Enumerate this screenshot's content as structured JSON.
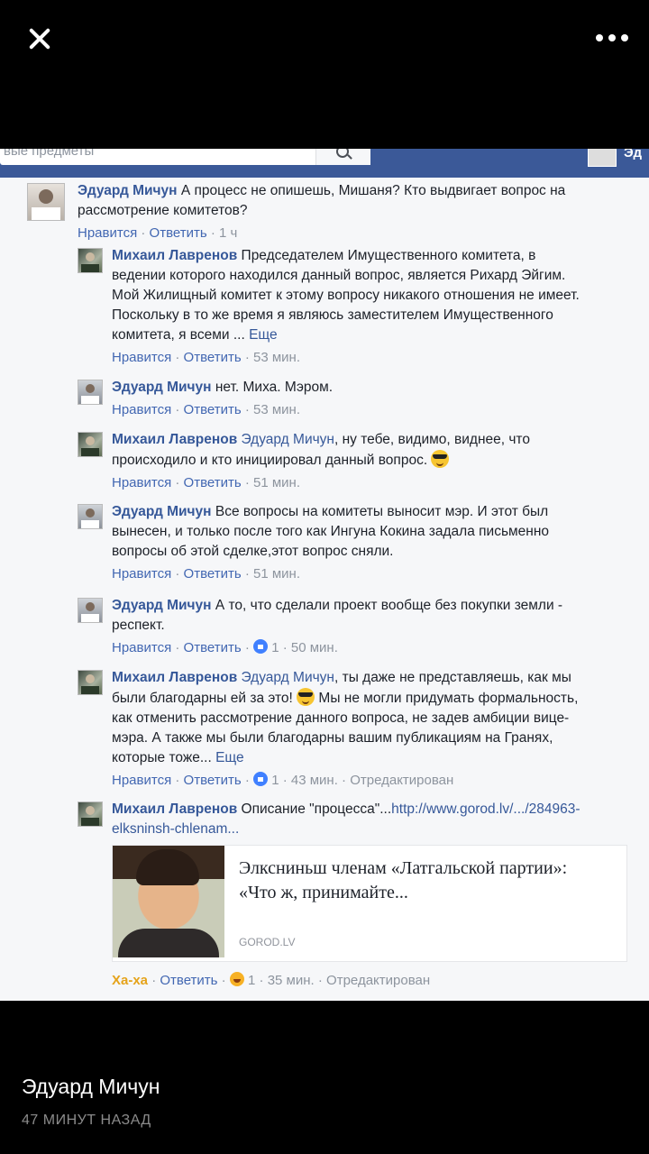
{
  "story": {
    "author": "Эдуард Мичун",
    "time": "47 МИНУТ НАЗАД",
    "close_icon": "close-icon",
    "more_icon": "more-icon"
  },
  "facebook": {
    "search_text": "вые предметы",
    "user_name": "Эд"
  },
  "comments": [
    {
      "author": "Эдуард Мичун",
      "text": "А процесс не опишешь, Мишаня? Кто выдвигает вопрос на рассмотрение комитетов?",
      "like": "Нравится",
      "reply": "Ответить",
      "time": "1 ч"
    },
    {
      "author": "Михаил Лавренов",
      "text": "Председателем Имущественного комитета, в ведении которого находился данный вопрос, является Рихард Эйгим. Мой Жилищный комитет к этому вопросу никакого отношения не имеет. Поскольку в то же время я являюсь заместителем Имущественного комитета, я всеми ...",
      "more": "Еще",
      "like": "Нравится",
      "reply": "Ответить",
      "time": "53 мин."
    },
    {
      "author": "Эдуард Мичун",
      "text": "нет. Миха. Мэром.",
      "like": "Нравится",
      "reply": "Ответить",
      "time": "53 мин."
    },
    {
      "author": "Михаил Лавренов",
      "mention": "Эдуард Мичун",
      "text": ", ну тебе, видимо, виднее, что происходило и кто инициировал данный вопрос.",
      "like": "Нравится",
      "reply": "Ответить",
      "time": "51 мин."
    },
    {
      "author": "Эдуард Мичун",
      "text": "Все вопросы на комитеты выносит мэр. И этот был вынесен, и только после того как Ингуна Кокина задала письменно вопросы об этой сделке,этот вопрос сняли.",
      "like": "Нравится",
      "reply": "Ответить",
      "time": "51 мин."
    },
    {
      "author": "Эдуард Мичун",
      "text": "А то, что сделали проект вообще без покупки земли - респект.",
      "like": "Нравится",
      "reply": "Ответить",
      "reactions": "1",
      "time": "50 мин."
    },
    {
      "author": "Михаил Лавренов",
      "mention": "Эдуард Мичун",
      "text_a": ", ты даже не представляешь, как мы были благодарны ей за это!",
      "text_b": "Мы не могли придумать формальность, как отменить рассмотрение данного вопроса, не задев амбиции вице-мэра. А также мы были благодарны вашим публикациям на Гранях, которые тоже...",
      "more": "Еще",
      "like": "Нравится",
      "reply": "Ответить",
      "reactions": "1",
      "time": "43 мин.",
      "edited": "Отредактирован"
    },
    {
      "author": "Михаил Лавренов",
      "text": "Описание \"процесса\"...",
      "link": "http://www.gorod.lv/.../284963-elksninsh-chlenam...",
      "like": "Ха-ха",
      "reply": "Ответить",
      "reactions": "1",
      "time": "35 мин.",
      "edited": "Отредактирован"
    }
  ],
  "link_card": {
    "title": "Элксниньш членам «Латгальской партии»: «Что ж, принимайте...",
    "domain": "GOROD.LV"
  }
}
